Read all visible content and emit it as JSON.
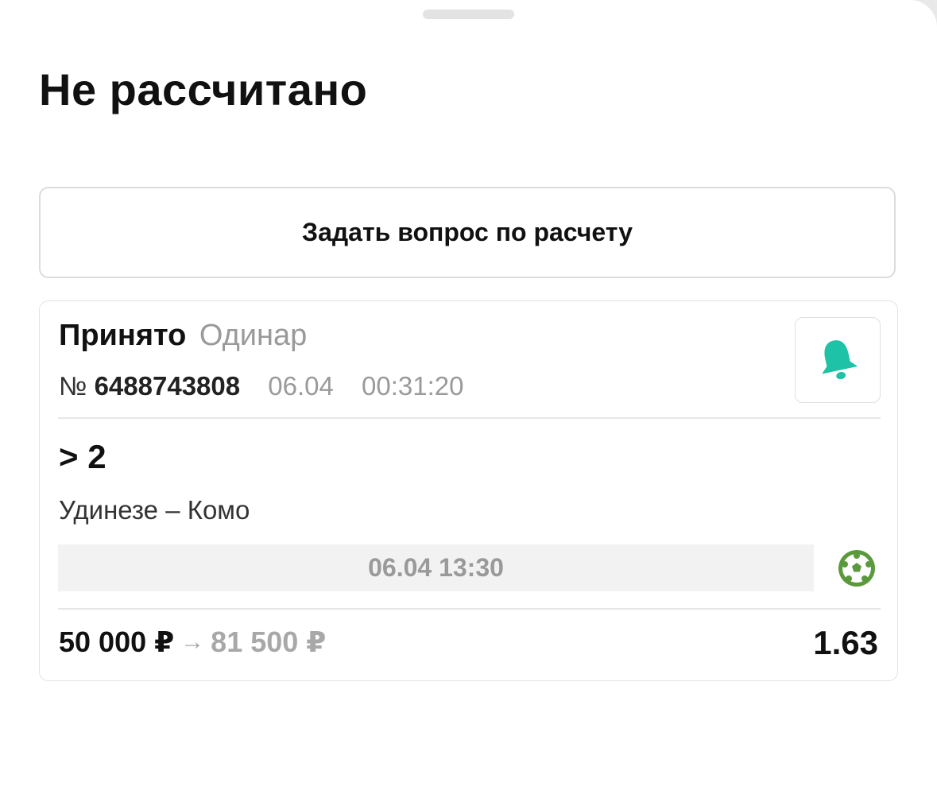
{
  "header": {
    "title": "Не рассчитано"
  },
  "actions": {
    "ask_question_label": "Задать вопрос по расчету"
  },
  "bet": {
    "status": "Принято",
    "type": "Одинар",
    "number_prefix": "№",
    "number": "6488743808",
    "date": "06.04",
    "time": "00:31:20",
    "outcome": "> 2",
    "match": "Удинезе – Комо",
    "event_datetime": "06.04 13:30",
    "sport_icon": "football-icon",
    "stake": "50 000 ₽",
    "arrow": "→",
    "payout": "81 500 ₽",
    "odds": "1.63"
  },
  "colors": {
    "accent": "#1ec2a6",
    "sport_icon": "#5a9a3c",
    "muted_text": "#9a9a9a"
  }
}
